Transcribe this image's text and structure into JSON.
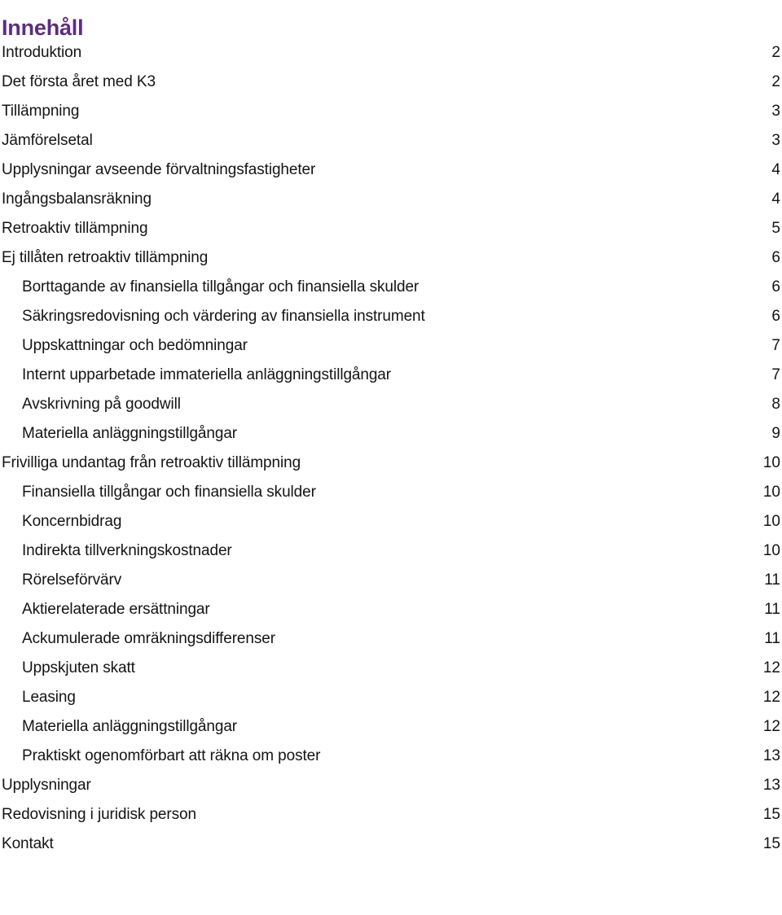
{
  "document": {
    "title": "Innehåll",
    "title_color": "#5c2d82",
    "text_color": "#141414",
    "background_color": "#ffffff"
  },
  "toc": {
    "entries": [
      {
        "label": "Introduktion",
        "page": "2",
        "level": 1
      },
      {
        "label": "Det första året med K3",
        "page": "2",
        "level": 1
      },
      {
        "label": "Tillämpning",
        "page": "3",
        "level": 1
      },
      {
        "label": "Jämförelsetal",
        "page": "3",
        "level": 1
      },
      {
        "label": "Upplysningar avseende förvaltningsfastigheter",
        "page": "4",
        "level": 1
      },
      {
        "label": "Ingångsbalansräkning",
        "page": "4",
        "level": 1
      },
      {
        "label": "Retroaktiv tillämpning",
        "page": "5",
        "level": 1
      },
      {
        "label": "Ej tillåten retroaktiv tillämpning",
        "page": "6",
        "level": 1
      },
      {
        "label": "Borttagande av finansiella tillgångar och finansiella skulder",
        "page": "6",
        "level": 2
      },
      {
        "label": "Säkringsredovisning och värdering av finansiella instrument",
        "page": "6",
        "level": 2
      },
      {
        "label": "Uppskattningar och bedömningar",
        "page": "7",
        "level": 2
      },
      {
        "label": "Internt upparbetade immateriella anläggningstillgångar",
        "page": "7",
        "level": 2
      },
      {
        "label": "Avskrivning på goodwill",
        "page": "8",
        "level": 2
      },
      {
        "label": "Materiella anläggningstillgångar",
        "page": "9",
        "level": 2
      },
      {
        "label": "Frivilliga undantag från retroaktiv tillämpning",
        "page": "10",
        "level": 1
      },
      {
        "label": "Finansiella tillgångar och finansiella skulder",
        "page": "10",
        "level": 2
      },
      {
        "label": "Koncernbidrag",
        "page": "10",
        "level": 2
      },
      {
        "label": "Indirekta tillverkningskostnader",
        "page": "10",
        "level": 2
      },
      {
        "label": "Rörelseförvärv",
        "page": "11",
        "level": 2
      },
      {
        "label": "Aktierelaterade ersättningar",
        "page": "11",
        "level": 2
      },
      {
        "label": "Ackumulerade omräkningsdifferenser",
        "page": "11",
        "level": 2
      },
      {
        "label": "Uppskjuten skatt",
        "page": "12",
        "level": 2
      },
      {
        "label": "Leasing",
        "page": "12",
        "level": 2
      },
      {
        "label": "Materiella anläggningstillgångar",
        "page": "12",
        "level": 2
      },
      {
        "label": "Praktiskt ogenomförbart att räkna om poster",
        "page": "13",
        "level": 2
      },
      {
        "label": "Upplysningar",
        "page": "13",
        "level": 1
      },
      {
        "label": "Redovisning i juridisk person",
        "page": "15",
        "level": 1
      },
      {
        "label": "Kontakt",
        "page": "15",
        "level": 1
      }
    ]
  }
}
